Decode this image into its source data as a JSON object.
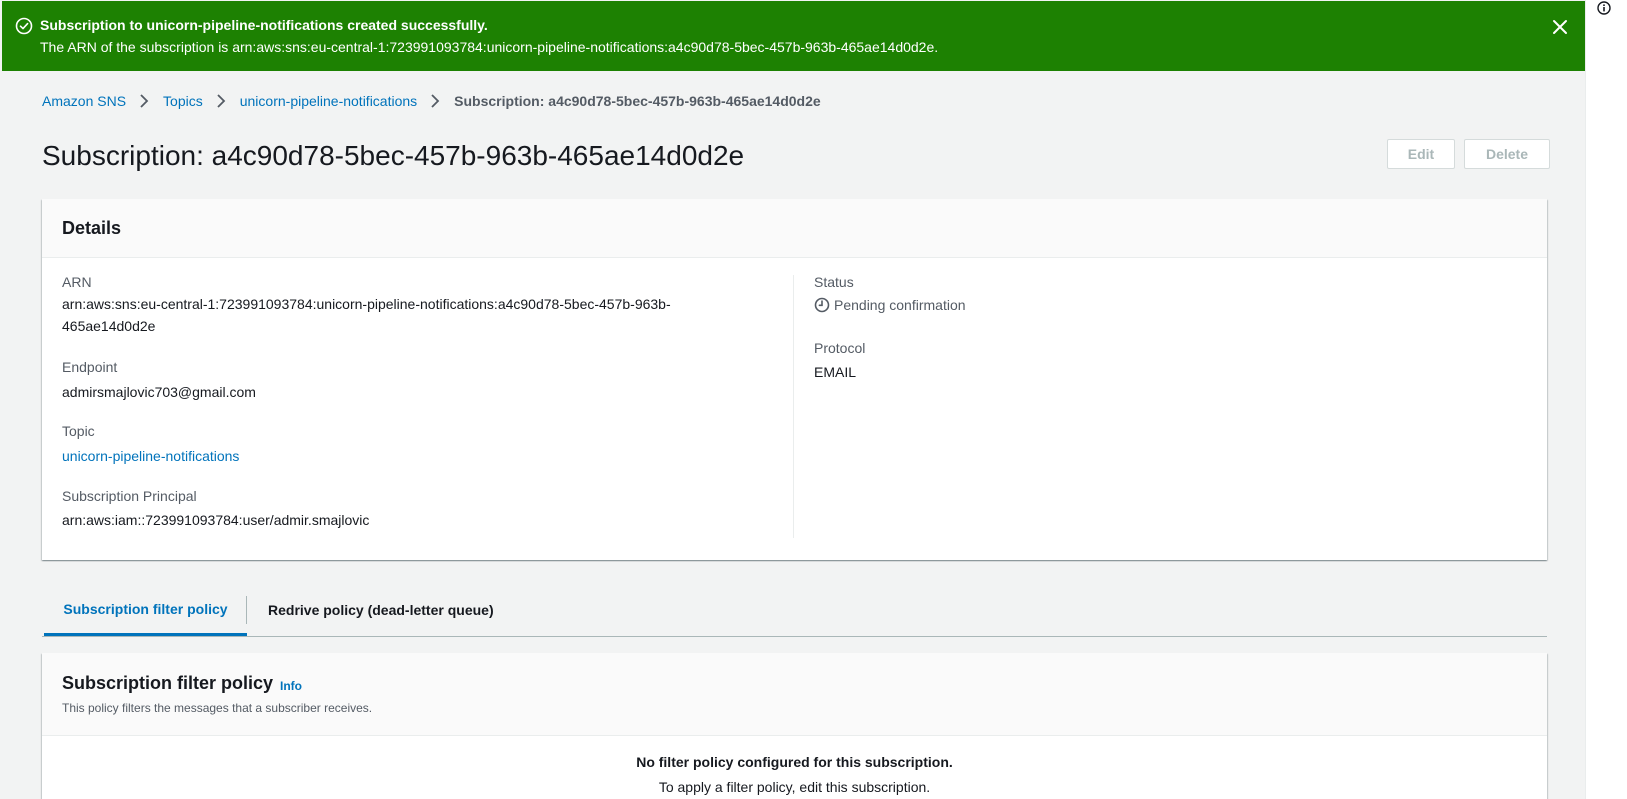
{
  "flash": {
    "title": "Subscription to unicorn-pipeline-notifications created successfully.",
    "message": "The ARN of the subscription is arn:aws:sns:eu-central-1:723991093784:unicorn-pipeline-notifications:a4c90d78-5bec-457b-963b-465ae14d0d2e.",
    "icon": "check-circle-icon",
    "color": "#1d8102"
  },
  "breadcrumb": {
    "items": [
      "Amazon SNS",
      "Topics",
      "unicorn-pipeline-notifications"
    ],
    "current": "Subscription: a4c90d78-5bec-457b-963b-465ae14d0d2e"
  },
  "page": {
    "title": "Subscription: a4c90d78-5bec-457b-963b-465ae14d0d2e",
    "edit_label": "Edit",
    "delete_label": "Delete"
  },
  "details": {
    "heading": "Details",
    "arn_label": "ARN",
    "arn_value_line1": "arn:aws:sns:eu-central-1:723991093784:unicorn-pipeline-notifications:a4c90d78-5bec-457b-963b-",
    "arn_value_line2": "465ae14d0d2e",
    "endpoint_label": "Endpoint",
    "endpoint_value": "admirsmajlovic703@gmail.com",
    "topic_label": "Topic",
    "topic_value": "unicorn-pipeline-notifications",
    "principal_label": "Subscription Principal",
    "principal_value": "arn:aws:iam::723991093784:user/admir.smajlovic",
    "status_label": "Status",
    "status_value": "Pending confirmation",
    "protocol_label": "Protocol",
    "protocol_value": "EMAIL"
  },
  "tabs": {
    "active": "Subscription filter policy",
    "inactive": "Redrive policy (dead-letter queue)"
  },
  "filter": {
    "title": "Subscription filter policy",
    "info": "Info",
    "description": "This policy filters the messages that a subscriber receives.",
    "empty_title": "No filter policy configured for this subscription.",
    "empty_desc": "To apply a filter policy, edit this subscription."
  }
}
